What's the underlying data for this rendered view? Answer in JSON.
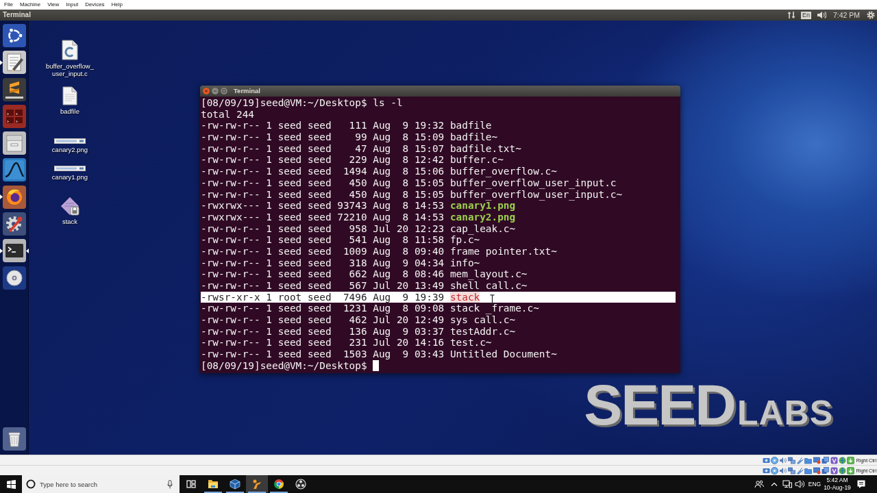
{
  "vm_menu": [
    "File",
    "Machine",
    "View",
    "Input",
    "Devices",
    "Help"
  ],
  "top_panel": {
    "app_title": "Terminal",
    "keyboard_layout": "En",
    "clock": "7:42 PM"
  },
  "launcher": [
    {
      "kind": "dash",
      "running": false,
      "focused": false
    },
    {
      "kind": "text_editor",
      "running": true,
      "focused": false
    },
    {
      "kind": "code_editor",
      "running": false,
      "focused": false
    },
    {
      "kind": "split_terminal",
      "running": false,
      "focused": false
    },
    {
      "kind": "file_cabinet",
      "running": false,
      "focused": false
    },
    {
      "kind": "packet_analyzer",
      "running": false,
      "focused": false
    },
    {
      "kind": "web_browser",
      "running": true,
      "focused": false
    },
    {
      "kind": "system_settings",
      "running": false,
      "focused": false
    },
    {
      "kind": "terminal",
      "running": true,
      "focused": true
    },
    {
      "kind": "disc",
      "running": false,
      "focused": false
    },
    {
      "kind": "trash",
      "running": false,
      "focused": false
    }
  ],
  "desktop_icons": [
    {
      "kind": "c_source",
      "label": "buffer_overflow_user_input.c"
    },
    {
      "kind": "text",
      "label": "badfile"
    },
    {
      "kind": "image",
      "label": "canary2.png"
    },
    {
      "kind": "image",
      "label": "canary1.png"
    },
    {
      "kind": "executable",
      "label": "stack"
    }
  ],
  "terminal": {
    "title": "Terminal",
    "lines": [
      {
        "kind": "prompt",
        "prompt": "[08/09/19]seed@VM:~/Desktop$",
        "command": "ls -l",
        "cursor": false
      },
      {
        "kind": "output",
        "text": "total 244"
      },
      {
        "kind": "regular_file",
        "info": "-rw-rw-r-- 1 seed seed   111 Aug  9 19:32",
        "name": "badfile",
        "selected": false
      },
      {
        "kind": "regular_file",
        "info": "-rw-rw-r-- 1 seed seed    99 Aug  8 15:09",
        "name": "badfile~",
        "selected": false
      },
      {
        "kind": "regular_file",
        "info": "-rw-rw-r-- 1 seed seed    47 Aug  8 15:07",
        "name": "badfile.txt~",
        "selected": false
      },
      {
        "kind": "regular_file",
        "info": "-rw-rw-r-- 1 seed seed   229 Aug  8 12:42",
        "name": "buffer.c~",
        "selected": false
      },
      {
        "kind": "regular_file",
        "info": "-rw-rw-r-- 1 seed seed  1494 Aug  8 15:06",
        "name": "buffer_overflow.c~",
        "selected": false
      },
      {
        "kind": "regular_file",
        "info": "-rw-rw-r-- 1 seed seed   450 Aug  8 15:05",
        "name": "buffer_overflow_user_input.c",
        "selected": false
      },
      {
        "kind": "regular_file",
        "info": "-rw-rw-r-- 1 seed seed   450 Aug  8 15:05",
        "name": "buffer_overflow_user_input.c~",
        "selected": false
      },
      {
        "kind": "executable_file",
        "info": "-rwxrwx--- 1 seed seed 93743 Aug  8 14:53",
        "name": "canary1.png",
        "selected": false
      },
      {
        "kind": "executable_file",
        "info": "-rwxrwx--- 1 seed seed 72210 Aug  8 14:53",
        "name": "canary2.png",
        "selected": false
      },
      {
        "kind": "regular_file",
        "info": "-rw-rw-r-- 1 seed seed   958 Jul 20 12:23",
        "name": "cap_leak.c~",
        "selected": false
      },
      {
        "kind": "regular_file",
        "info": "-rw-rw-r-- 1 seed seed   541 Aug  8 11:58",
        "name": "fp.c~",
        "selected": false
      },
      {
        "kind": "regular_file",
        "info": "-rw-rw-r-- 1 seed seed  1009 Aug  8 09:40",
        "name": "frame pointer.txt~",
        "selected": false
      },
      {
        "kind": "regular_file",
        "info": "-rw-rw-r-- 1 seed seed   318 Aug  9 04:34",
        "name": "info~",
        "selected": false
      },
      {
        "kind": "regular_file",
        "info": "-rw-rw-r-- 1 seed seed   662 Aug  8 08:46",
        "name": "mem_layout.c~",
        "selected": false
      },
      {
        "kind": "regular_file",
        "info": "-rw-rw-r-- 1 seed seed   567 Jul 20 13:49",
        "name": "shell call.c~",
        "selected": false
      },
      {
        "kind": "setuid_file",
        "info": "-rwsr-xr-x 1 root seed  7496 Aug  9 19:39",
        "name": "stack",
        "selected": true
      },
      {
        "kind": "regular_file",
        "info": "-rw-rw-r-- 1 seed seed  1231 Aug  8 09:08",
        "name": "stack _frame.c~",
        "selected": false
      },
      {
        "kind": "regular_file",
        "info": "-rw-rw-r-- 1 seed seed   462 Jul 20 12:49",
        "name": "sys call.c~",
        "selected": false
      },
      {
        "kind": "regular_file",
        "info": "-rw-rw-r-- 1 seed seed   136 Aug  9 03:37",
        "name": "testAddr.c~",
        "selected": false
      },
      {
        "kind": "regular_file",
        "info": "-rw-rw-r-- 1 seed seed   231 Jul 20 14:16",
        "name": "test.c~",
        "selected": false
      },
      {
        "kind": "regular_file",
        "info": "-rw-rw-r-- 1 seed seed  1503 Aug  9 03:43",
        "name": "Untitled Document~",
        "selected": false
      },
      {
        "kind": "prompt",
        "prompt": "[08/09/19]seed@VM:~/Desktop$",
        "cursor": true
      }
    ]
  },
  "wallpaper_logo": [
    "SEED",
    "LABS"
  ],
  "vm_status_bars": [
    {
      "host_key": "Right Ctrl"
    },
    {
      "host_key": "Right Ctrl"
    }
  ],
  "taskbar": {
    "search": {
      "placeholder": "Type here to search"
    },
    "apps": [
      {
        "kind": "task_view",
        "running": false,
        "selected": false
      },
      {
        "kind": "file_explorer",
        "running": true,
        "selected": false
      },
      {
        "kind": "virtual_machines",
        "running": true,
        "selected": false
      },
      {
        "kind": "figure_app",
        "running": true,
        "selected": true
      },
      {
        "kind": "web_browser",
        "running": true,
        "selected": false
      },
      {
        "kind": "screen_recorder",
        "running": false,
        "selected": false
      }
    ],
    "language": "ENG",
    "time": "5:42 AM",
    "date": "10-Aug-19"
  }
}
